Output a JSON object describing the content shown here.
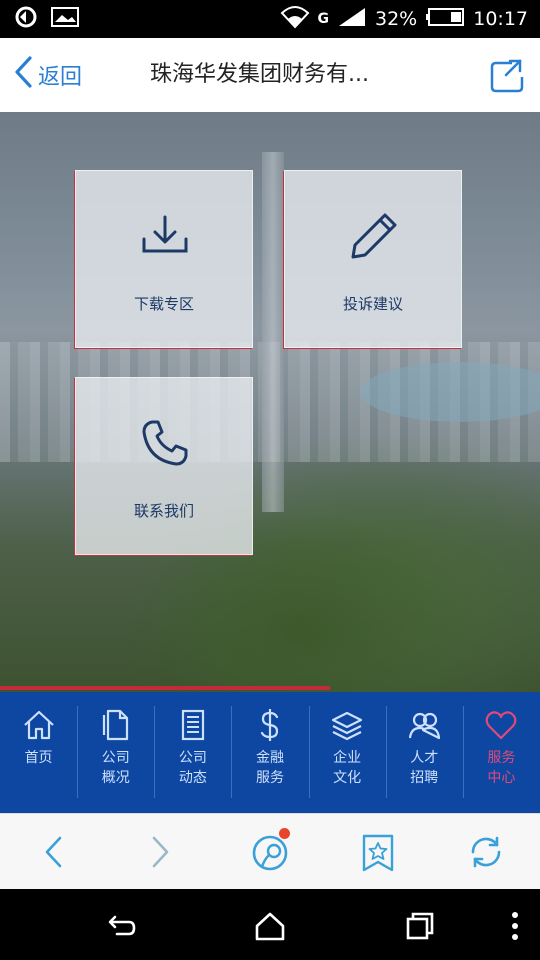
{
  "status_bar": {
    "battery": "32%",
    "time": "10:17",
    "network": "G"
  },
  "title_bar": {
    "back_label": "返回",
    "title": "珠海华发集团财务有..."
  },
  "tiles": [
    {
      "label": "下载专区",
      "icon": "download-icon"
    },
    {
      "label": "投诉建议",
      "icon": "pencil-icon"
    },
    {
      "label": "联系我们",
      "icon": "phone-icon"
    }
  ],
  "bottom_nav": {
    "items": [
      {
        "label": "首页",
        "icon": "home-icon"
      },
      {
        "label": "公司概况",
        "icon": "document-icon"
      },
      {
        "label": "公司动态",
        "icon": "news-icon"
      },
      {
        "label": "金融服务",
        "icon": "dollar-icon"
      },
      {
        "label": "企业文化",
        "icon": "layers-icon"
      },
      {
        "label": "人才招聘",
        "icon": "people-icon"
      },
      {
        "label": "服务中心",
        "icon": "heart-icon",
        "active": true
      }
    ]
  },
  "colors": {
    "accent": "#2b7fd3",
    "nav_bg": "#0d47a1",
    "active": "#e04a7a",
    "badge": "#e8452d"
  }
}
